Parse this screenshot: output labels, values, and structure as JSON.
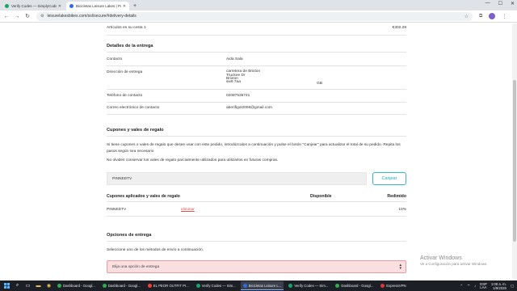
{
  "browser": {
    "tabs": [
      {
        "title": "Verify Codes — SimplyCodes",
        "active": false
      },
      {
        "title": "Bicicletas Leisure Lakes | Pagar",
        "active": true
      }
    ],
    "new_tab": "+",
    "url": "leisurelakesbikes.com/ssl/secure/#delivery-details"
  },
  "summary": {
    "items_label": "Artículos en su cesta",
    "items_count": "1",
    "items_total": "€302.28"
  },
  "delivery": {
    "heading": "Detalles de la entrega",
    "contact_label": "Contacto",
    "contact_value": "Aida Sala",
    "address_label": "Dirección de entrega",
    "address_lines": [
      "carretera de Brixton",
      "Truckee Dr",
      "Brixton",
      "sw9 7aa"
    ],
    "country": "GB",
    "phone_label": "Teléfono de contacto",
    "phone_value": "02087536741",
    "email_label": "Correo electrónico de contacto",
    "email_value": "aberifigol2008@gmail.com"
  },
  "coupons": {
    "heading": "Cupones y vales de regalo",
    "intro": "Si tiene cupones o vales de regalo que desee usar con este pedido, introdúzcalos a continuación y pulse el botón \"Canjear\" para actualizar el total de su pedido. Repita los pasos según sea necesario",
    "note": "No olvides conservar los vales de regalo parcialmente utilizados para utilizarlos en futuras compras.",
    "input_value": "PINNEDTV",
    "apply_button": "Canjear",
    "applied_header": "Cupones aplicados y vales de regalo",
    "col_available": "Disponible",
    "col_redeemed": "Redimido",
    "applied": [
      {
        "code": "PINNEDTV",
        "action": "eliminar",
        "available": "",
        "redeemed": "10%"
      }
    ]
  },
  "shipping": {
    "heading": "Opciones de entrega",
    "instruction": "Seleccione uno de los métodos de envío a continuación.",
    "select_placeholder": "Elija una opción de entrega"
  },
  "watermark": {
    "line1": "Activar Windows",
    "line2": "Ve a Configuración para activar Windows."
  },
  "taskbar": {
    "tasks": [
      {
        "label": "Dashboard - Googl...",
        "color": "#34a853"
      },
      {
        "label": "Dashboard - Googl...",
        "color": "#34a853"
      },
      {
        "label": "EL PEOR OUTFIT PI...",
        "color": "#ea4335"
      },
      {
        "label": "Verify Codes — Sim...",
        "color": "#17a66a"
      },
      {
        "label": "Bicicletas Leisure L...",
        "color": "#2c6ee0",
        "active": true
      },
      {
        "label": "Verify Codes — Sim...",
        "color": "#17a66a"
      },
      {
        "label": "Dashboard - Googl...",
        "color": "#34a853"
      },
      {
        "label": "ExpressVPN",
        "color": "#da3940"
      }
    ],
    "lang": "ESP\nLAA",
    "time": "1:08 a. m.",
    "date": "1/9/2025"
  }
}
